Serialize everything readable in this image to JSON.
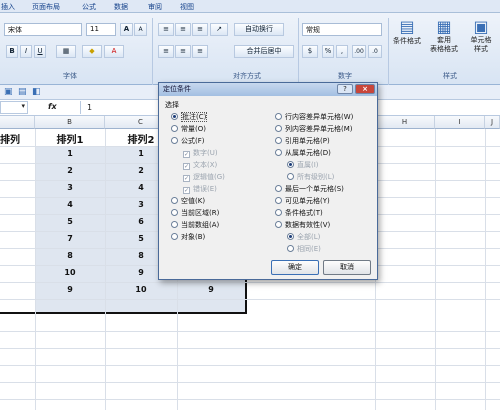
{
  "ribbon": {
    "tabs": [
      "插入",
      "页面布局",
      "公式",
      "数据",
      "审阅",
      "视图"
    ],
    "font_name": "宋体",
    "font_size": "11",
    "grow_font": "A",
    "shrink_font": "A",
    "bold": "B",
    "italic": "I",
    "underline": "U",
    "wrap_text": "自动换行",
    "merge_center": "合并后居中",
    "number_format": "常规",
    "percent": "%",
    "comma": ",",
    "dec_up": ".00",
    "dec_down": ".0",
    "group_font": "字体",
    "group_align": "对齐方式",
    "group_number": "数字",
    "group_style": "样式",
    "cond_format": "条件格式",
    "table_format": "套用\n表格格式",
    "cell_style": "单元格\n样式"
  },
  "formula_bar": {
    "fx": "fx",
    "value": "1"
  },
  "sheet": {
    "col_headers": [
      "B",
      "C",
      "H",
      "I",
      "J"
    ],
    "header_row": [
      "排列",
      "排列1",
      "排列2"
    ],
    "rows": [
      [
        "1",
        "1"
      ],
      [
        "2",
        "2"
      ],
      [
        "3",
        "4"
      ],
      [
        "4",
        "3"
      ],
      [
        "5",
        "6"
      ],
      [
        "7",
        "5"
      ],
      [
        "8",
        "8"
      ],
      [
        "10",
        "9"
      ],
      [
        "9",
        "10"
      ]
    ],
    "extra_col": [
      "9",
      "9"
    ]
  },
  "dialog": {
    "title": "定位条件",
    "help": "?",
    "close": "×",
    "section": "选择",
    "left_options": [
      "批注(C)",
      "常量(O)",
      "公式(F)"
    ],
    "formula_sub": [
      "数字(U)",
      "文本(X)",
      "逻辑值(G)",
      "错误(E)"
    ],
    "left_options2": [
      "空值(K)",
      "当前区域(R)",
      "当前数组(A)",
      "对象(B)"
    ],
    "right_options": [
      "行内容差异单元格(W)",
      "列内容差异单元格(M)",
      "引用单元格(P)",
      "从属单元格(D)"
    ],
    "dependent_sub": [
      "直属(I)",
      "所有级别(L)"
    ],
    "right_options2": [
      "最后一个单元格(S)",
      "可见单元格(Y)",
      "条件格式(T)",
      "数据有效性(V)"
    ],
    "validation_sub": [
      "全部(L)",
      "相同(E)"
    ],
    "ok": "确定",
    "cancel": "取消"
  }
}
